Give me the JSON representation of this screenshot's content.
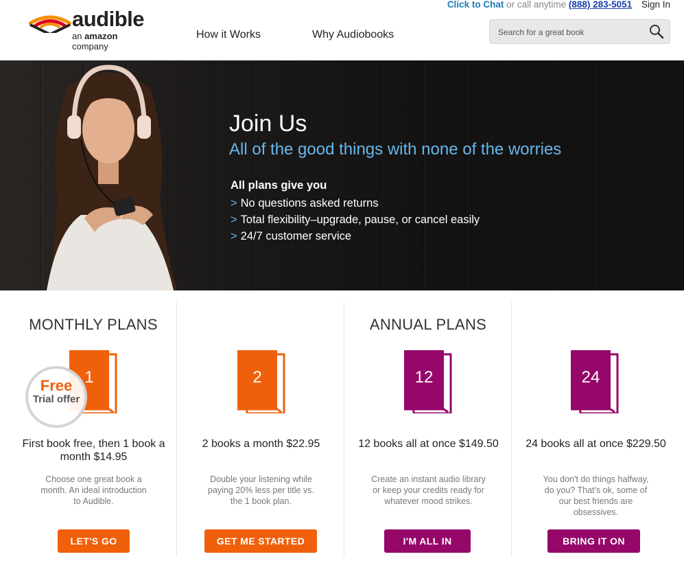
{
  "brand": {
    "name": "audible",
    "tagline_prefix": "an ",
    "tagline_brand": "amazon",
    "tagline_suffix": " company"
  },
  "nav": {
    "how_it_works": "How it Works",
    "why_audiobooks": "Why Audiobooks"
  },
  "topbar": {
    "chat": "Click to Chat",
    "call": " or call anytime ",
    "phone": "(888) 283-5051",
    "sign_in": "Sign In"
  },
  "search": {
    "placeholder": "Search for a great book"
  },
  "hero": {
    "title": "Join Us",
    "subtitle": "All of the good things with none of the worries",
    "list_heading": "All plans give you",
    "bullet_marker": ">",
    "benefits": [
      "No questions asked returns",
      "Total flexibility–upgrade, pause, or cancel easily",
      "24/7 customer service"
    ]
  },
  "plans": {
    "monthly_heading": "MONTHLY PLANS",
    "annual_heading": "ANNUAL PLANS",
    "free_badge": {
      "line1": "Free",
      "line2": "Trial offer"
    },
    "items": [
      {
        "count": "1",
        "title": "First book free, then 1 book a month $14.95",
        "description": "Choose one great book a month. An ideal introduction to Audible.",
        "cta": "LET'S GO",
        "color": "#f0600b"
      },
      {
        "count": "2",
        "title": "2 books a month $22.95",
        "description": "Double your listening while paying 20% less per title vs. the 1 book plan.",
        "cta": "GET ME STARTED",
        "color": "#f0600b"
      },
      {
        "count": "12",
        "title": "12 books all at once $149.50",
        "description": "Create an instant audio library or keep your credits ready for whatever mood strikes.",
        "cta": "I'M ALL IN",
        "color": "#95086a"
      },
      {
        "count": "24",
        "title": "24 books all at once $229.50",
        "description": "You don't do things halfway, do you? That's ok, some of our best friends are obsessives.",
        "cta": "BRING IT ON",
        "color": "#95086a"
      }
    ]
  },
  "colors": {
    "accent_orange": "#f0600b",
    "accent_purple": "#95086a",
    "hero_blue": "#66b8ec",
    "link_blue": "#1a3fb0"
  },
  "icons": {
    "search": "magnifier-icon",
    "logo": "audible-signal-icon",
    "book": "book-icon"
  }
}
